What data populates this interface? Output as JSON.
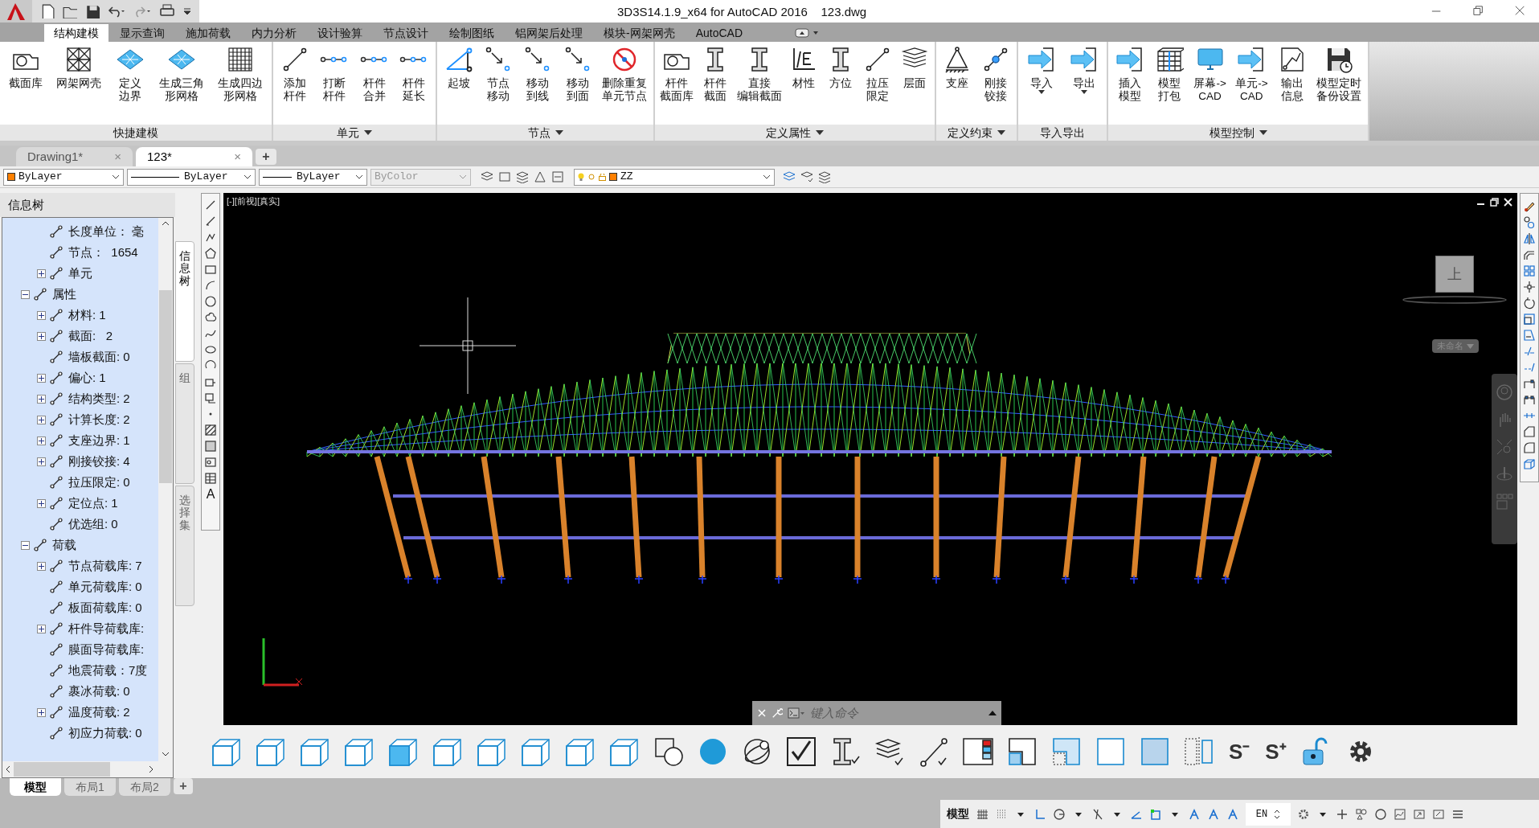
{
  "window": {
    "title": "3D3S14.1.9_x64 for AutoCAD 2016    123.dwg"
  },
  "menu_tabs": [
    {
      "label": "结构建模",
      "selected": true
    },
    {
      "label": "显示查询",
      "selected": false
    },
    {
      "label": "施加荷载",
      "selected": false
    },
    {
      "label": "内力分析",
      "selected": false
    },
    {
      "label": "设计验算",
      "selected": false
    },
    {
      "label": "节点设计",
      "selected": false
    },
    {
      "label": "绘制图纸",
      "selected": false
    },
    {
      "label": "铝网架后处理",
      "selected": false
    },
    {
      "label": "模块-网架网壳",
      "selected": false
    },
    {
      "label": "AutoCAD",
      "selected": false
    }
  ],
  "ribbon": {
    "panels": [
      {
        "title": "快捷建模",
        "has_menu": false,
        "buttons": [
          {
            "lines": [
              "截面库"
            ]
          },
          {
            "lines": [
              "网架网壳"
            ]
          },
          {
            "lines": [
              "定义",
              "边界"
            ]
          },
          {
            "lines": [
              "生成三角",
              "形网格"
            ]
          },
          {
            "lines": [
              "生成四边",
              "形网格"
            ]
          }
        ]
      },
      {
        "title": "单元",
        "has_menu": true,
        "buttons": [
          {
            "lines": [
              "添加",
              "杆件"
            ]
          },
          {
            "lines": [
              "打断",
              "杆件"
            ]
          },
          {
            "lines": [
              "杆件",
              "合并"
            ]
          },
          {
            "lines": [
              "杆件",
              "延长"
            ]
          }
        ]
      },
      {
        "title": "节点",
        "has_menu": true,
        "buttons": [
          {
            "lines": [
              "起坡"
            ]
          },
          {
            "lines": [
              "节点",
              "移动"
            ]
          },
          {
            "lines": [
              "移动",
              "到线"
            ]
          },
          {
            "lines": [
              "移动",
              "到面"
            ]
          },
          {
            "lines": [
              "删除重复",
              "单元节点"
            ]
          }
        ]
      },
      {
        "title": "定义属性",
        "has_menu": true,
        "buttons": [
          {
            "lines": [
              "杆件",
              "截面库"
            ]
          },
          {
            "lines": [
              "杆件",
              "截面"
            ]
          },
          {
            "lines": [
              "直接",
              "编辑截面"
            ]
          },
          {
            "lines": [
              "材性"
            ]
          },
          {
            "lines": [
              "方位"
            ]
          },
          {
            "lines": [
              "拉压",
              "限定"
            ]
          },
          {
            "lines": [
              "层面"
            ]
          }
        ]
      },
      {
        "title": "定义约束",
        "has_menu": true,
        "buttons": [
          {
            "lines": [
              "支座"
            ]
          },
          {
            "lines": [
              "刚接",
              "铰接"
            ]
          }
        ]
      },
      {
        "title": "导入导出",
        "has_menu": false,
        "buttons": [
          {
            "lines": [
              "导入"
            ],
            "dropdown": true
          },
          {
            "lines": [
              "导出"
            ],
            "dropdown": true
          }
        ]
      },
      {
        "title": "模型控制",
        "has_menu": true,
        "buttons": [
          {
            "lines": [
              "插入",
              "模型"
            ]
          },
          {
            "lines": [
              "模型",
              "打包"
            ]
          },
          {
            "lines": [
              "屏幕->",
              "CAD"
            ]
          },
          {
            "lines": [
              "单元->",
              "CAD"
            ]
          },
          {
            "lines": [
              "输出",
              "信息"
            ]
          },
          {
            "lines": [
              "模型定时",
              "备份设置"
            ]
          }
        ]
      }
    ]
  },
  "doc_tabs": [
    {
      "label": "Drawing1*",
      "selected": false,
      "close": "×"
    },
    {
      "label": "123*",
      "selected": true,
      "close": "×"
    }
  ],
  "new_tab": "+",
  "properties_bar": {
    "color_setting": "ByLayer",
    "linetype": "ByLayer",
    "lineweight": "ByLayer",
    "plot_style": {
      "value": "ByColor",
      "disabled": true
    },
    "layer": "ZZ"
  },
  "info_tree": {
    "title": "信息树",
    "items": [
      {
        "children": [
          {
            "label": "长度单位： 毫"
          },
          {
            "label": "节点：  1654"
          },
          {
            "label": "单元",
            "expanded": false
          }
        ]
      },
      {
        "label": "属性",
        "expanded": true,
        "children": [
          {
            "label": "材料: 1",
            "expanded": false
          },
          {
            "label": "截面:   2",
            "expanded": false
          },
          {
            "label": "墙板截面: 0"
          },
          {
            "label": "偏心: 1",
            "expanded": false
          },
          {
            "label": "结构类型: 2",
            "expanded": false
          },
          {
            "label": "计算长度: 2",
            "expanded": false
          },
          {
            "label": "支座边界: 1",
            "expanded": false
          },
          {
            "label": "刚接铰接: 4",
            "expanded": false
          },
          {
            "label": "拉压限定: 0"
          },
          {
            "label": "定位点: 1",
            "expanded": false
          },
          {
            "label": "优选组: 0"
          }
        ]
      },
      {
        "label": "荷载",
        "expanded": true,
        "children": [
          {
            "label": "节点荷载库: 7",
            "expanded": false
          },
          {
            "label": "单元荷载库: 0"
          },
          {
            "label": "板面荷载库: 0"
          },
          {
            "label": "杆件导荷载库:",
            "expanded": false
          },
          {
            "label": "膜面导荷载库:"
          },
          {
            "label": "地震荷载：7度"
          },
          {
            "label": "裹冰荷载: 0"
          },
          {
            "label": "温度荷载: 2",
            "expanded": false
          },
          {
            "label": "初应力荷载: 0"
          }
        ]
      }
    ]
  },
  "vertical_tabs": [
    {
      "label": "信息树",
      "selected": true
    },
    {
      "label": "组",
      "selected": false
    },
    {
      "label": "选择集",
      "selected": false
    }
  ],
  "draw_toolbar": {
    "text_tool": "A"
  },
  "viewport": {
    "label": "[-][前视][真实]",
    "viewcube_face": "上",
    "view_name": "未命名"
  },
  "command_line": {
    "placeholder": "键入命令"
  },
  "bottom_toolbar": {
    "text_buttons": [
      "S⁻",
      "S⁺"
    ]
  },
  "layout_tabs": [
    {
      "label": "模型",
      "selected": true
    },
    {
      "label": "布局1",
      "selected": false
    },
    {
      "label": "布局2",
      "selected": false
    }
  ],
  "new_layout": "+",
  "status_bar": {
    "space": "模型",
    "language": "EN"
  }
}
